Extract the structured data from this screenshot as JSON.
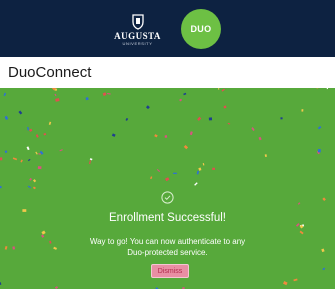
{
  "header": {
    "university_name": "AUGUSTA",
    "university_subtitle": "UNIVERSITY",
    "duo_logo_text": "DUO",
    "colors": {
      "background": "#0d2241",
      "duo_green": "#6dc044"
    }
  },
  "page": {
    "title": "DuoConnect"
  },
  "enrollment": {
    "icon": "check-circle-icon",
    "title": "Enrollment Successful!",
    "message_line1": "Way to go! You can now authenticate to any",
    "message_line2": "Duo-protected service.",
    "dismiss_label": "Dismiss",
    "colors": {
      "panel": "#57a93b",
      "dismiss_button": "#e98fa4"
    }
  }
}
